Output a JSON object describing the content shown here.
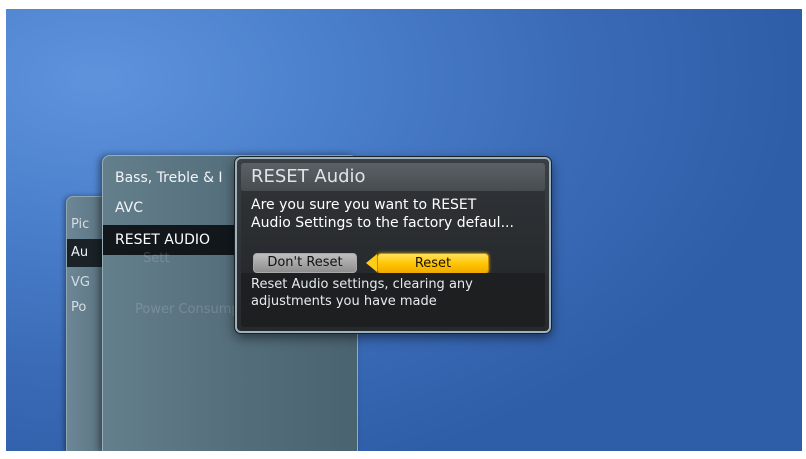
{
  "back_menu": {
    "items": [
      {
        "label": "Pic"
      },
      {
        "label": "Au"
      },
      {
        "label": "VG"
      },
      {
        "label": "Po"
      }
    ]
  },
  "audio_menu": {
    "items": [
      {
        "label": "Bass, Treble & I"
      },
      {
        "label": "AVC"
      },
      {
        "label": "RESET AUDIO"
      }
    ],
    "ghost_labels": [
      "Sett",
      "Power Consumption"
    ]
  },
  "dialog": {
    "title": "RESET Audio",
    "message_line1": "Are you sure you want to RESET",
    "message_line2": "Audio Settings to the factory defaul...",
    "dont_reset_label": "Don't Reset",
    "reset_label": "Reset",
    "help_line1": "Reset Audio settings, clearing any",
    "help_line2": "adjustments you have made"
  },
  "colors": {
    "focus": "#ffc200",
    "background": "#4a7fcb"
  }
}
